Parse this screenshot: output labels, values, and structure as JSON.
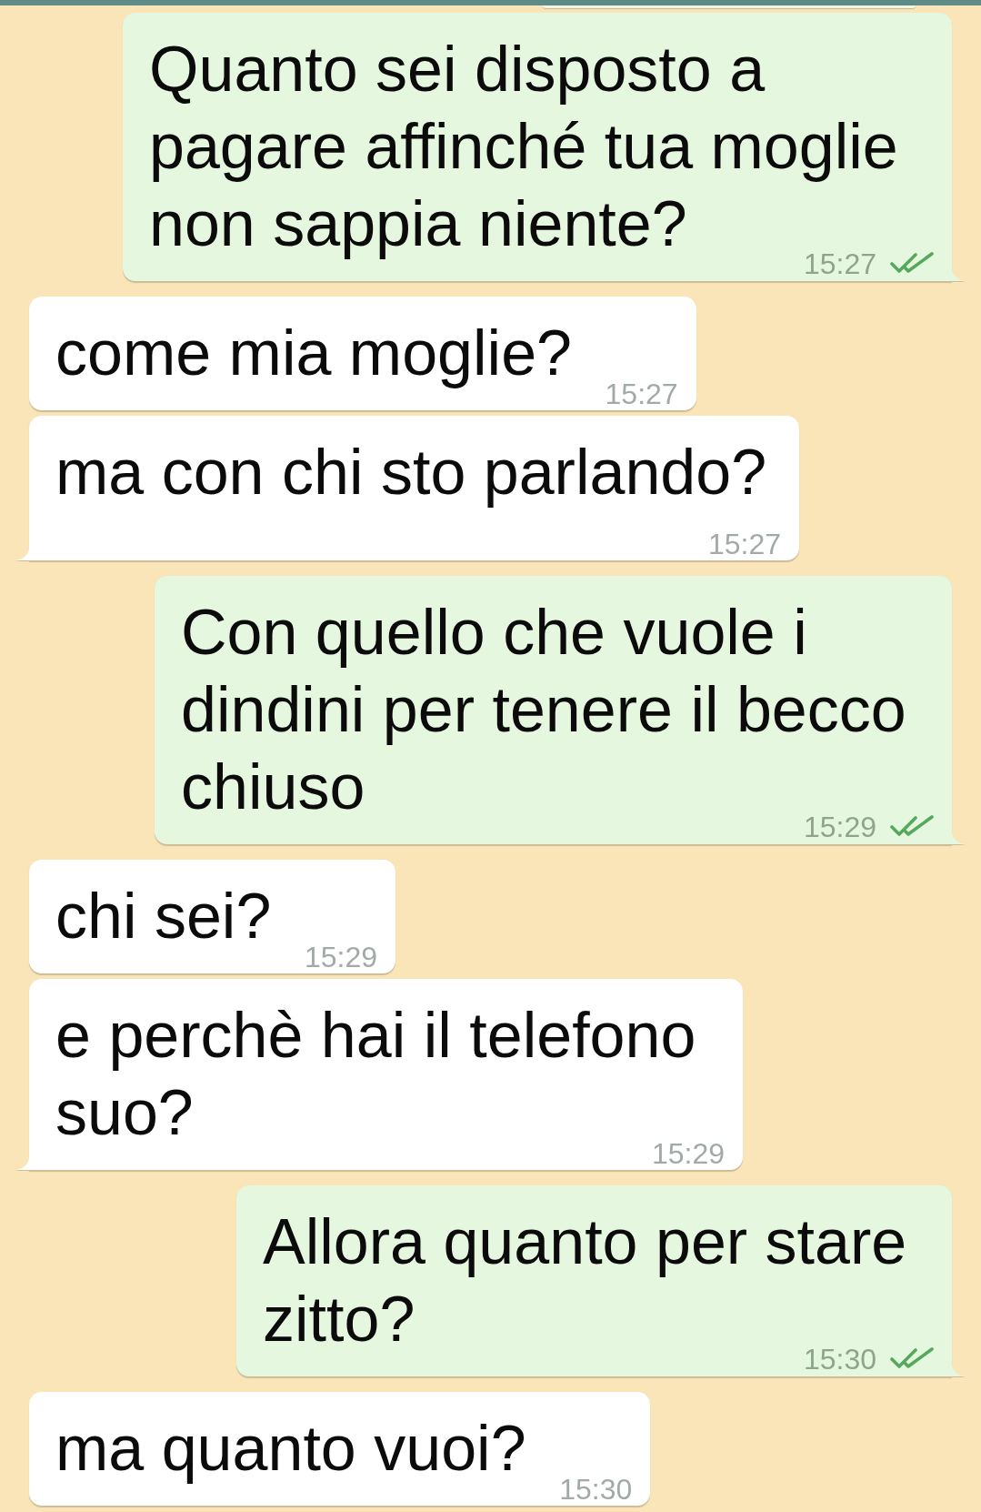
{
  "messages": [
    {
      "kind": "outgoing",
      "text": "Quanto sei disposto a pagare affinché tua moglie non sappia niente?",
      "time": "15:27",
      "read": true
    },
    {
      "kind": "incoming",
      "text": "come mia moglie?",
      "time": "15:27"
    },
    {
      "kind": "incoming",
      "text": "ma con chi sto parlando?",
      "time": "15:27"
    },
    {
      "kind": "outgoing",
      "text": "Con quello che vuole i dindini per tenere il becco chiuso",
      "time": "15:29",
      "read": true
    },
    {
      "kind": "incoming",
      "text": "chi sei?",
      "time": "15:29"
    },
    {
      "kind": "incoming",
      "text": "e perchè hai il telefono suo?",
      "time": "15:29"
    },
    {
      "kind": "outgoing",
      "text": "Allora quanto per stare zitto?",
      "time": "15:30",
      "read": true
    },
    {
      "kind": "incoming",
      "text": "ma quanto vuoi?",
      "time": "15:30"
    }
  ]
}
